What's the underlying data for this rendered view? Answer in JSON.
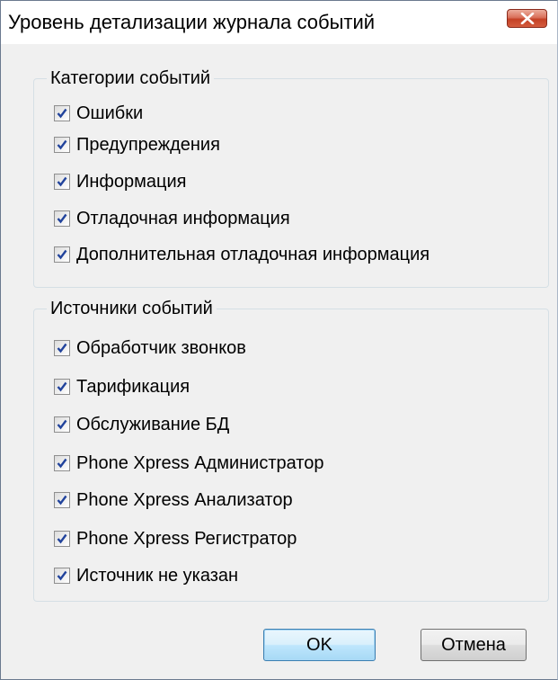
{
  "window": {
    "title": "Уровень детализации журнала событий"
  },
  "categories": {
    "legend": "Категории событий",
    "items": [
      {
        "label": "Ошибки",
        "checked": true
      },
      {
        "label": "Предупреждения",
        "checked": true
      },
      {
        "label": "Информация",
        "checked": true
      },
      {
        "label": "Отладочная информация",
        "checked": true
      },
      {
        "label": "Дополнительная отладочная информация",
        "checked": true
      }
    ]
  },
  "sources": {
    "legend": "Источники событий",
    "items": [
      {
        "label": "Обработчик звонков",
        "checked": true
      },
      {
        "label": "Тарификация",
        "checked": true
      },
      {
        "label": "Обслуживание БД",
        "checked": true
      },
      {
        "label": "Phone Xpress Администратор",
        "checked": true
      },
      {
        "label": "Phone Xpress Анализатор",
        "checked": true
      },
      {
        "label": "Phone Xpress Регистратор",
        "checked": true
      },
      {
        "label": "Источник не указан",
        "checked": true
      }
    ]
  },
  "buttons": {
    "ok_label": "OK",
    "cancel_label": "Отмена"
  },
  "colors": {
    "window_bg": "#f0f0f0",
    "close_button": "#c44125",
    "checkmark": "#21439c",
    "default_button_border": "#3c7fb1"
  }
}
